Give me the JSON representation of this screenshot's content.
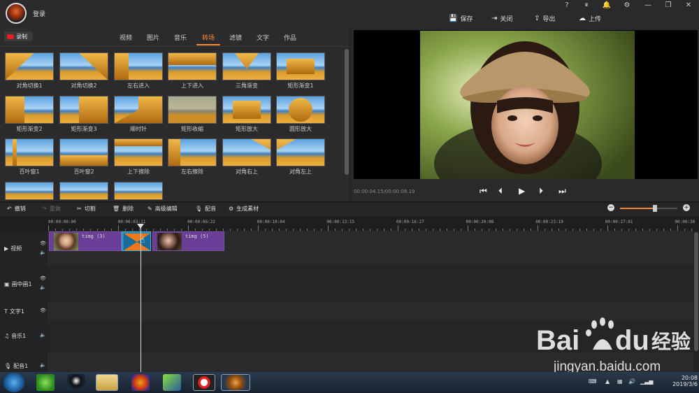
{
  "header": {
    "login_label": "登录",
    "window_controls": [
      "?",
      "VIP",
      "bell",
      "gear",
      "minimize",
      "restore",
      "close"
    ],
    "actions": [
      {
        "label": "保存",
        "icon": "save-icon"
      },
      {
        "label": "关闭",
        "icon": "exit-icon"
      },
      {
        "label": "导出",
        "icon": "export-icon"
      },
      {
        "label": "上传",
        "icon": "upload-icon"
      }
    ]
  },
  "media_panel": {
    "record_label": "录制",
    "tabs": [
      "视频",
      "图片",
      "音乐",
      "转场",
      "滤镜",
      "文字",
      "作品"
    ],
    "active_tab": "转场",
    "transitions": [
      "对角切换1",
      "对角切换2",
      "左右进入",
      "上下进入",
      "三角渐变",
      "矩形渐变1",
      "矩形渐变2",
      "矩形渐变3",
      "顺时针",
      "矩形收缩",
      "矩形放大",
      "圆形放大",
      "百叶窗1",
      "百叶窗2",
      "上下擦除",
      "左右擦除",
      "对角右上",
      "对角左上"
    ]
  },
  "preview": {
    "timecode": "00:00:04.15/00:00:08.19"
  },
  "toolbar": {
    "undo": "撤销",
    "redo": "重做",
    "cut": "切割",
    "delete": "删除",
    "advanced_edit": "高级编辑",
    "dub": "配音",
    "generate": "生成素材"
  },
  "timeline": {
    "ruler_labels": [
      "00:00:00:00",
      "00:00:03:11",
      "00:00:06:22",
      "00:00:10:04",
      "00:00:13:15",
      "00:00:16:27",
      "00:00:20:08",
      "00:00:23:19",
      "00:00:27:01",
      "00:00:30"
    ],
    "tracks": [
      "视频",
      "画中画1",
      "文字1",
      "音乐1",
      "配音1"
    ],
    "clips": [
      {
        "label": "timg (3)"
      },
      {
        "label": "timg (5)"
      }
    ]
  },
  "taskbar": {
    "time": "20:08",
    "date": "2019/3/6"
  },
  "watermark": {
    "brand": "Bai du经验",
    "url": "jingyan.baidu.com"
  }
}
